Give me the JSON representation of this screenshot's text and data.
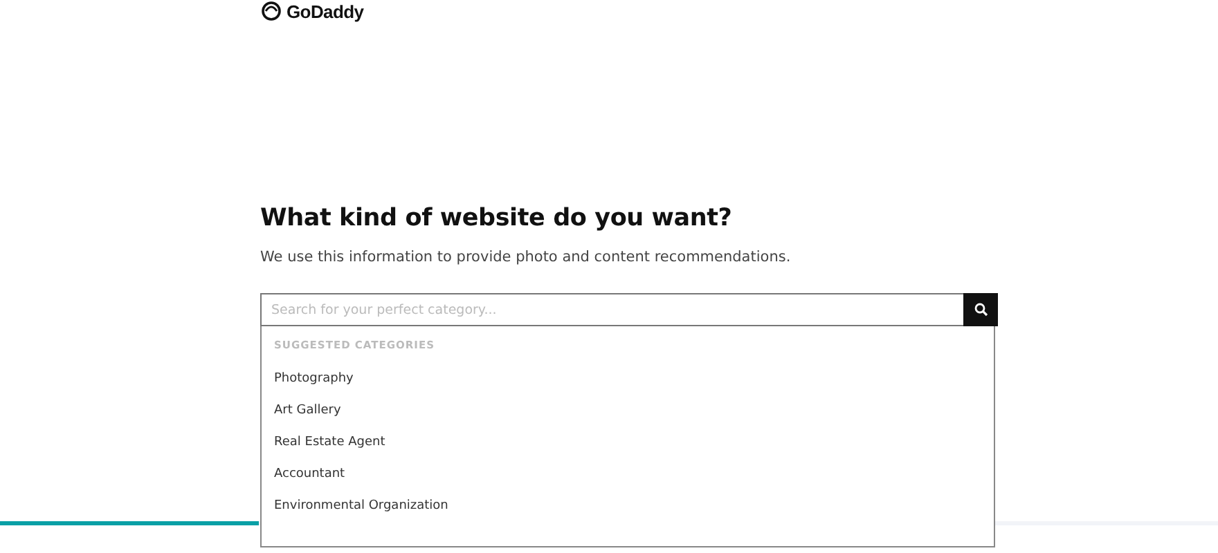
{
  "logo": {
    "text": "GoDaddy"
  },
  "heading": "What kind of website do you want?",
  "subheading": "We use this information to provide photo and content recommendations.",
  "search": {
    "placeholder": "Search for your perfect category..."
  },
  "suggestions": {
    "title": "SUGGESTED CATEGORIES",
    "items": [
      "Photography",
      "Art Gallery",
      "Real Estate Agent",
      "Accountant",
      "Environmental Organization"
    ]
  },
  "progress": {
    "level": 0.213
  }
}
